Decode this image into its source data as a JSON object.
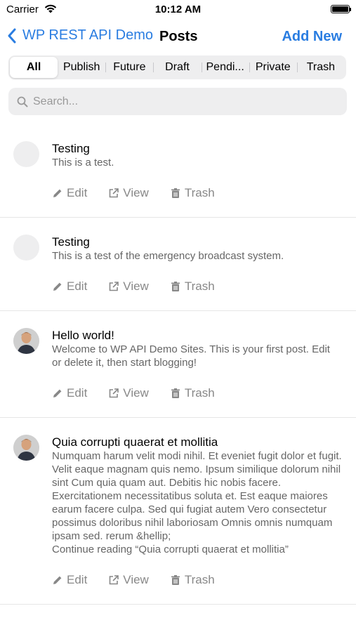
{
  "status_bar": {
    "carrier": "Carrier",
    "time": "10:12 AM"
  },
  "nav": {
    "back_label": "WP REST API Demo",
    "title": "Posts",
    "action_label": "Add New"
  },
  "tabs": [
    {
      "label": "All",
      "active": true
    },
    {
      "label": "Publish"
    },
    {
      "label": "Future"
    },
    {
      "label": "Draft"
    },
    {
      "label": "Pendi..."
    },
    {
      "label": "Private"
    },
    {
      "label": "Trash"
    }
  ],
  "search": {
    "placeholder": "Search..."
  },
  "actions": {
    "edit": "Edit",
    "view": "View",
    "trash": "Trash"
  },
  "posts": [
    {
      "title": "Testing",
      "excerpt": "This is a test.",
      "avatar": "placeholder"
    },
    {
      "title": "Testing",
      "excerpt": "This is a test of the emergency broadcast system.",
      "avatar": "placeholder"
    },
    {
      "title": "Hello world!",
      "excerpt": "Welcome to WP API Demo Sites. This is your first post. Edit or delete it, then start blogging!",
      "avatar": "photo"
    },
    {
      "title": "Quia corrupti quaerat et mollitia",
      "excerpt": "Numquam harum velit modi nihil. Et eveniet fugit dolor et fugit. Velit eaque magnam quis nemo. Ipsum similique dolorum nihil sint Cum quia quam aut. Debitis hic nobis facere. Exercitationem necessitatibus soluta et. Est eaque maiores earum facere culpa. Sed qui fugiat autem Vero consectetur possimus doloribus nihil laboriosam Omnis omnis numquam ipsam sed. rerum &hellip;\nContinue reading “Quia corrupti quaerat et mollitia”",
      "avatar": "photo"
    }
  ],
  "colors": {
    "accent": "#2a7de1",
    "muted": "#888888",
    "segment_bg": "#eeeeef"
  }
}
